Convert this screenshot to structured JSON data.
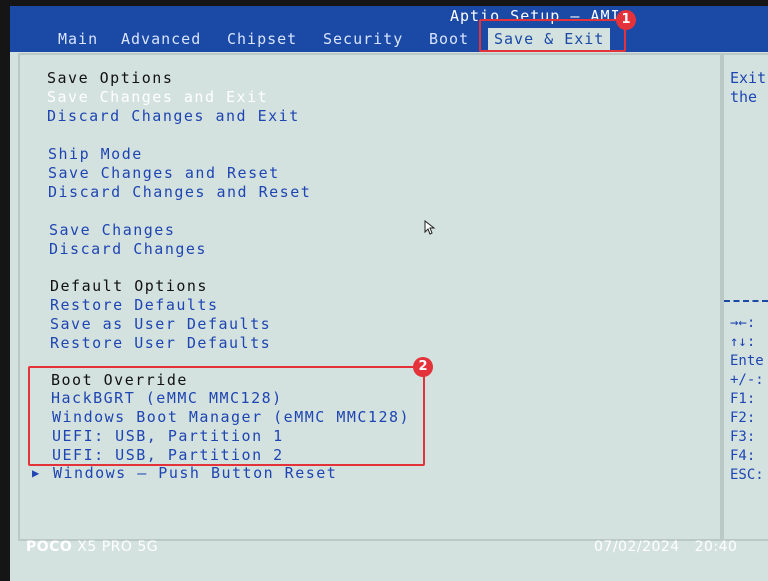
{
  "header": {
    "title": "Aptio Setup – AMI",
    "tabs": [
      {
        "label": "Main"
      },
      {
        "label": "Advanced"
      },
      {
        "label": "Chipset"
      },
      {
        "label": "Security"
      },
      {
        "label": "Boot"
      },
      {
        "label": "Save & Exit",
        "active": true
      }
    ]
  },
  "menu": {
    "save_options_heading": "Save Options",
    "save_changes_and_exit": "Save Changes and Exit",
    "discard_changes_and_exit": "Discard Changes and Exit",
    "ship_mode": "Ship Mode",
    "save_changes_and_reset": "Save Changes and Reset",
    "discard_changes_and_reset": "Discard Changes and Reset",
    "save_changes": "Save Changes",
    "discard_changes": "Discard Changes",
    "default_options_heading": "Default Options",
    "restore_defaults": "Restore Defaults",
    "save_as_user_defaults": "Save as User Defaults",
    "restore_user_defaults": "Restore User Defaults",
    "boot_override_heading": "Boot Override",
    "boot_items": [
      "HackBGRT (eMMC MMC128)",
      "Windows Boot Manager (eMMC MMC128)",
      "UEFI:  USB, Partition 1",
      "UEFI:  USB, Partition 2"
    ],
    "windows_reset": "Windows – Push Button Reset"
  },
  "help": {
    "line1": "Exit",
    "line2": "the"
  },
  "keys": [
    "→←:",
    "↑↓:",
    "Ente",
    "+/-:",
    "F1:",
    "F2:",
    "F3:",
    "F4:",
    "ESC:"
  ],
  "annotations": {
    "badge1": "1",
    "badge2": "2",
    "color": "#e4323b"
  },
  "watermark": {
    "brand": "POCO",
    "model": " X5 PRO 5G",
    "date": "07/02/2024",
    "time": "20:40"
  },
  "colors": {
    "bios_blue": "#1a49a6",
    "bios_bg": "#d3e2de",
    "item_text": "#1f45b3"
  }
}
